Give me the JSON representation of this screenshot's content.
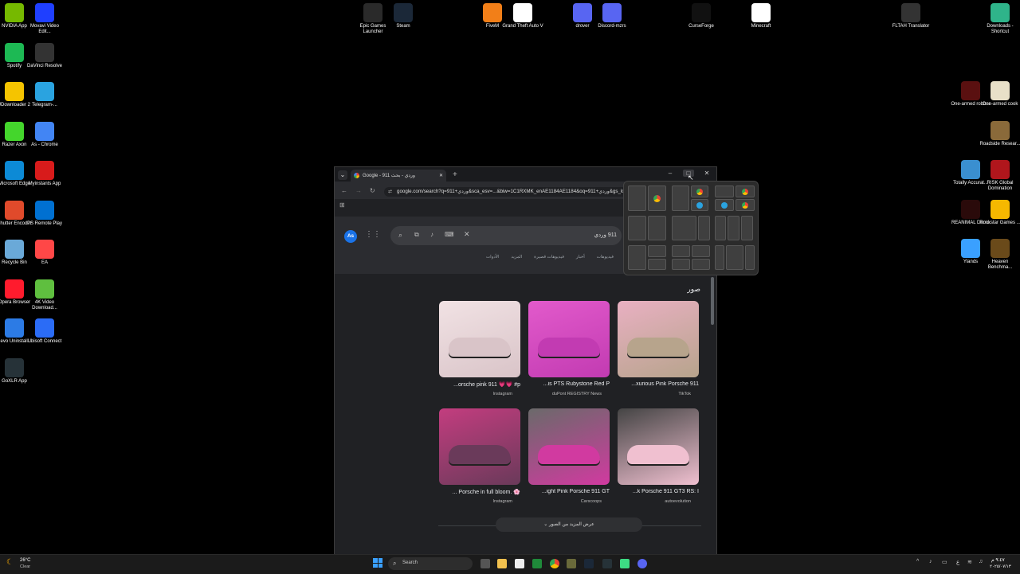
{
  "desktop": {
    "left_icons": [
      {
        "label": "NVIDIA App",
        "color": "#76b900",
        "glyph": "nvidia-icon"
      },
      {
        "label": "Movavi Video Edit...",
        "color": "#1f3fff",
        "glyph": "movavi-icon"
      },
      {
        "label": "Spotify",
        "color": "#1db954",
        "glyph": "spotify-icon"
      },
      {
        "label": "DaVinci Resolve",
        "color": "#333333",
        "glyph": "davinci-icon"
      },
      {
        "label": "JDownloader 2",
        "color": "#f5c400",
        "glyph": "jdownloader-icon"
      },
      {
        "label": "Telegram-...",
        "color": "#2aa3e0",
        "glyph": "telegram-icon"
      },
      {
        "label": "Razer Axon",
        "color": "#44d62c",
        "glyph": "razer-icon"
      },
      {
        "label": "As - Chrome",
        "color": "#4285f4",
        "glyph": "chrome-icon"
      },
      {
        "label": "Microsoft Edge",
        "color": "#0c8ad6",
        "glyph": "edge-icon"
      },
      {
        "label": "Myinstants App",
        "color": "#d81b1b",
        "glyph": "myinstants-icon"
      },
      {
        "label": "Shutter Encoder",
        "color": "#e04a2b",
        "glyph": "shutter-icon"
      },
      {
        "label": "PS Remote Play",
        "color": "#0070d1",
        "glyph": "ps-icon"
      },
      {
        "label": "Recycle Bin",
        "color": "#6aa9d8",
        "glyph": "recycle-bin-icon"
      },
      {
        "label": "EA",
        "color": "#ff4747",
        "glyph": "ea-icon"
      },
      {
        "label": "Opera Browser",
        "color": "#ff1b2d",
        "glyph": "opera-icon"
      },
      {
        "label": "4K Video Download...",
        "color": "#5fbf3f",
        "glyph": "4k-icon"
      },
      {
        "label": "Revo Uninstall...",
        "color": "#2c7be5",
        "glyph": "revo-icon"
      },
      {
        "label": "Ubisoft Connect",
        "color": "#2b6cf6",
        "glyph": "ubisoft-icon"
      },
      {
        "label": "GoXLR App",
        "color": "#263238",
        "glyph": "goxlr-icon"
      }
    ],
    "top_icons": [
      {
        "label": "Epic Games Launcher",
        "color": "#2a2a2a",
        "glyph": "epic-icon"
      },
      {
        "label": "Steam",
        "color": "#1b2838",
        "glyph": "steam-icon"
      },
      {
        "label": "FiveM",
        "color": "#f27f18",
        "glyph": "fivem-icon"
      },
      {
        "label": "Grand Theft Auto V",
        "color": "#ffffff",
        "glyph": "file-icon"
      },
      {
        "label": "drover",
        "color": "#5865f2",
        "glyph": "drover-icon"
      },
      {
        "label": "Discord-mzrs",
        "color": "#5865f2",
        "glyph": "discord-icon"
      },
      {
        "label": "CurseForge",
        "color": "#111111",
        "glyph": "curseforge-icon"
      },
      {
        "label": "Minecraft",
        "color": "#ffffff",
        "glyph": "file-icon"
      },
      {
        "label": "FLTAH Translator",
        "color": "#333333",
        "glyph": "fltah-icon"
      },
      {
        "label": "Downloads - Shortcut",
        "color": "#2fb48a",
        "glyph": "downloads-icon"
      }
    ],
    "right_icons": [
      {
        "label": "One-armed robber",
        "color": "#5a1010",
        "glyph": "game-icon"
      },
      {
        "label": "One-armed cook",
        "color": "#e8e0c8",
        "glyph": "game-icon"
      },
      {
        "label": "Roadside Resear...",
        "color": "#8a6a3a",
        "glyph": "game-icon"
      },
      {
        "label": "Totally Accurat...",
        "color": "#3a8fd0",
        "glyph": "game-icon"
      },
      {
        "label": "RISK Global Domination",
        "color": "#b0161c",
        "glyph": "game-icon"
      },
      {
        "label": "REANIMAL Demo",
        "color": "#2a0a0a",
        "glyph": "game-icon"
      },
      {
        "label": "Rockstar Games ...",
        "color": "#f5b800",
        "glyph": "rockstar-icon"
      },
      {
        "label": "Ylands",
        "color": "#3aa0ff",
        "glyph": "game-icon"
      },
      {
        "label": "Heaven Benchma...",
        "color": "#6a4a1a",
        "glyph": "game-icon"
      }
    ]
  },
  "browser": {
    "profile_button": "⌄",
    "tab_title": "Google - 911 وردي - بحث",
    "new_tab": "+",
    "minimize": "–",
    "maximize": "□",
    "close": "✕",
    "url": "google.com/search?q=911+وردي&sca_esv=...&biw=1C1RXMK_enAE1184AE1184&oq=911+وردي&gs_lcrp",
    "avatar": "As",
    "search_query": "911 وردي",
    "filters": [
      "الأدوات",
      "المزيد",
      "فيديوهات قصيرة",
      "أخبار",
      "فيديوهات"
    ],
    "section_title": "صور",
    "results": [
      {
        "caption": "...orsche pink 911 💗💗 #p",
        "source": "Instagram",
        "colors": [
          "#d9c4c8",
          "#f1e2e4"
        ]
      },
      {
        "caption": "...is PTS Rubystone Red P",
        "source": "duPont REGISTRY News",
        "colors": [
          "#c23bb2",
          "#e25acb"
        ]
      },
      {
        "caption": "...xurious Pink Porsche 911",
        "source": "TikTok",
        "colors": [
          "#b7a48c",
          "#e9b0c2"
        ]
      },
      {
        "caption": "... Porsche in full bloom. 🌸",
        "source": "Instagram",
        "colors": [
          "#6a3a5a",
          "#c33d7f"
        ]
      },
      {
        "caption": "...ight Pink Porsche 911 GT",
        "source": "Carscoops",
        "colors": [
          "#d13aa0",
          "#6a6a6a"
        ]
      },
      {
        "caption": "...k Porsche 911 GT3 RS: I",
        "source": "autoevolution",
        "colors": [
          "#f0c0d0",
          "#444444"
        ]
      }
    ],
    "more_images": "عرض المزيد من الصور"
  },
  "taskbar": {
    "weather_temp": "26°C",
    "weather_desc": "Clear",
    "search_label": "Search",
    "time": "٩:٤٧ م",
    "date": "٢٠٢٥/٠٧/١٣"
  }
}
